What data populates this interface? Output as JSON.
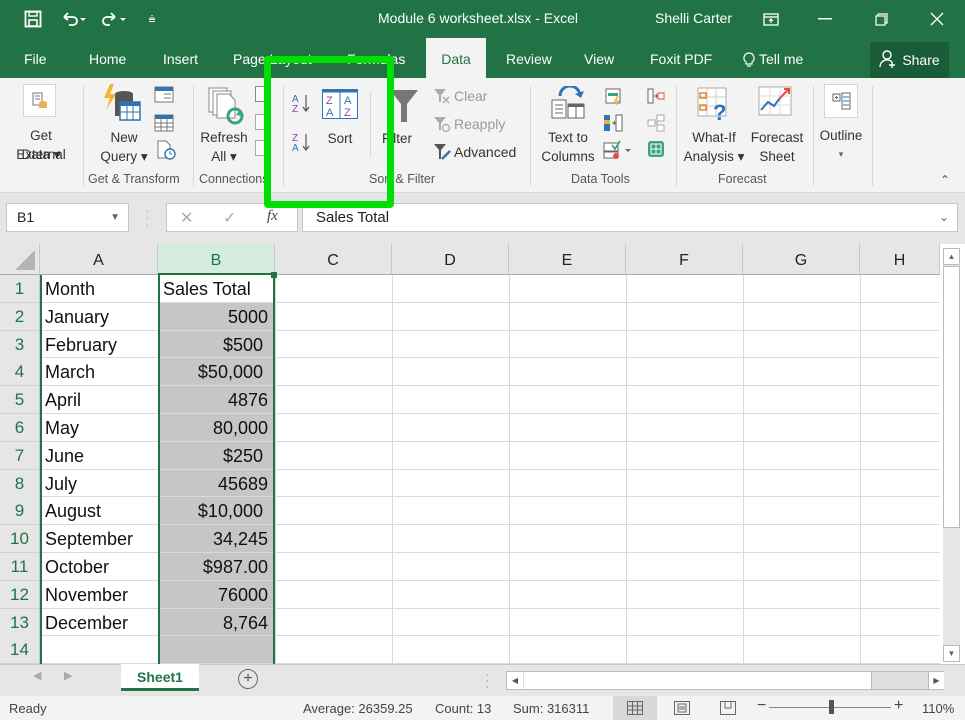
{
  "window": {
    "title": "Module 6 worksheet.xlsx  -  Excel",
    "user": "Shelli Carter",
    "quick_access": [
      "save-icon",
      "undo-icon",
      "redo-icon",
      "customize-icon"
    ],
    "controls": [
      "ribbon-display-icon",
      "minimize-icon",
      "restore-icon",
      "close-icon"
    ]
  },
  "tabs": [
    {
      "label": "File"
    },
    {
      "label": "Home"
    },
    {
      "label": "Insert"
    },
    {
      "label": "Page Layout"
    },
    {
      "label": "Formulas"
    },
    {
      "label": "Data",
      "active": true
    },
    {
      "label": "Review"
    },
    {
      "label": "View"
    },
    {
      "label": "Foxit PDF"
    },
    {
      "label": "Tell me"
    }
  ],
  "share_label": "Share",
  "ribbon": {
    "get_external": {
      "line1": "Get External",
      "line2": "Data ▾"
    },
    "new_query": {
      "line1": "New",
      "line2": "Query ▾"
    },
    "get_transform_label": "Get & Transform",
    "refresh": {
      "line1": "Refresh",
      "line2": "All ▾"
    },
    "connections_label": "Connections",
    "sort_label": "Sort",
    "filter_label": "Filter",
    "clear_label": "Clear",
    "reapply_label": "Reapply",
    "advanced_label": "Advanced",
    "sort_filter_label": "Sort & Filter",
    "text_to_columns": {
      "line1": "Text to",
      "line2": "Columns"
    },
    "data_tools_label": "Data Tools",
    "what_if": {
      "line1": "What-If",
      "line2": "Analysis ▾"
    },
    "forecast_sheet": {
      "line1": "Forecast",
      "line2": "Sheet"
    },
    "forecast_label": "Forecast",
    "outline_label": "Outline",
    "highlight_color": "#00e000"
  },
  "formula_bar": {
    "name_box": "B1",
    "fx": "fx",
    "value": "Sales Total"
  },
  "columns": [
    "A",
    "B",
    "C",
    "D",
    "E",
    "F",
    "G",
    "H"
  ],
  "selected_column": "B",
  "rows": [
    {
      "n": "1",
      "a": "Month",
      "b": "Sales Total"
    },
    {
      "n": "2",
      "a": "January",
      "b": "5000"
    },
    {
      "n": "3",
      "a": "February",
      "b": "$500 "
    },
    {
      "n": "4",
      "a": "March",
      "b": "$50,000 "
    },
    {
      "n": "5",
      "a": "April",
      "b": "4876"
    },
    {
      "n": "6",
      "a": "May",
      "b": "80,000"
    },
    {
      "n": "7",
      "a": "June",
      "b": "$250 "
    },
    {
      "n": "8",
      "a": "July",
      "b": "45689"
    },
    {
      "n": "9",
      "a": "August",
      "b": "$10,000 "
    },
    {
      "n": "10",
      "a": "September",
      "b": "34,245"
    },
    {
      "n": "11",
      "a": "October",
      "b": "$987.00"
    },
    {
      "n": "12",
      "a": "November",
      "b": "76000"
    },
    {
      "n": "13",
      "a": "December",
      "b": "8,764"
    },
    {
      "n": "14",
      "a": "",
      "b": ""
    }
  ],
  "sheets": [
    {
      "label": "Sheet1",
      "active": true
    }
  ],
  "status": {
    "mode": "Ready",
    "average": "Average: 26359.25",
    "count": "Count: 13",
    "sum": "Sum: 316311",
    "zoom": "110%",
    "zoom_percent": 110
  },
  "theme": {
    "accent": "#217346"
  }
}
